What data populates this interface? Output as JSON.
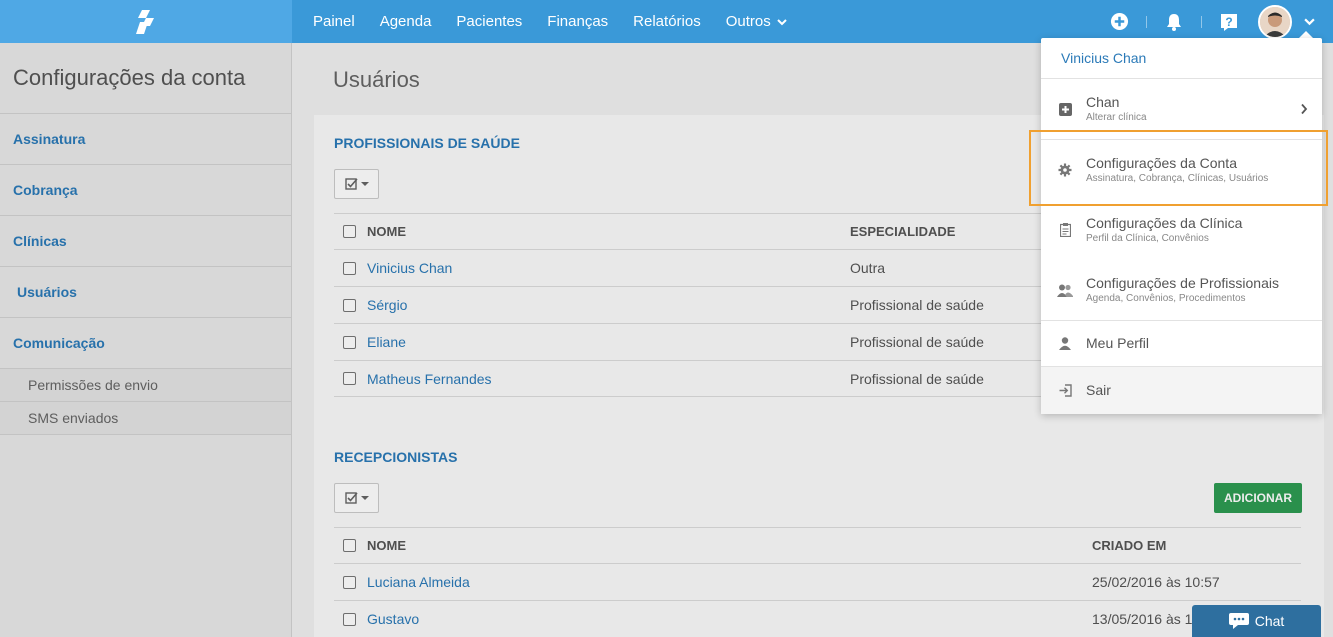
{
  "nav": {
    "items": [
      "Painel",
      "Agenda",
      "Pacientes",
      "Finanças",
      "Relatórios",
      "Outros"
    ]
  },
  "sidebar": {
    "title": "Configurações da conta",
    "items": [
      "Assinatura",
      "Cobrança",
      "Clínicas",
      "Usuários",
      "Comunicação"
    ],
    "active": "Usuários",
    "subitems": [
      "Permissões de envio",
      "SMS enviados"
    ]
  },
  "main": {
    "page_title": "Usuários",
    "professionals": {
      "title": "PROFISSIONAIS DE SAÚDE",
      "columns": [
        "NOME",
        "ESPECIALIDADE"
      ],
      "rows": [
        {
          "name": "Vinicius Chan",
          "specialty": "Outra"
        },
        {
          "name": "Sérgio",
          "specialty": "Profissional de saúde"
        },
        {
          "name": "Eliane",
          "specialty": "Profissional de saúde"
        },
        {
          "name": "Matheus Fernandes",
          "specialty": "Profissional de saúde"
        }
      ]
    },
    "receptionists": {
      "title": "RECEPCIONISTAS",
      "add_label": "ADICIONAR",
      "columns": [
        "NOME",
        "CRIADO EM"
      ],
      "rows": [
        {
          "name": "Luciana Almeida",
          "created": "25/02/2016 às 10:57"
        },
        {
          "name": "Gustavo",
          "created": "13/05/2016 às 1"
        }
      ]
    }
  },
  "dropdown": {
    "user_name": "Vinicius Chan",
    "items": [
      {
        "title": "Chan",
        "subtitle": "Alterar clínica",
        "icon": "plus-square-icon"
      },
      {
        "title": "Configurações da Conta",
        "subtitle": "Assinatura, Cobrança, Clínicas, Usuários",
        "icon": "gear-icon"
      },
      {
        "title": "Configurações da Clínica",
        "subtitle": "Perfil da Clínica, Convênios",
        "icon": "clipboard-icon"
      },
      {
        "title": "Configurações de Profissionais",
        "subtitle": "Agenda, Convênios, Procedimentos",
        "icon": "users-icon"
      },
      {
        "title": "Meu Perfil",
        "subtitle": "",
        "icon": "user-icon"
      },
      {
        "title": "Sair",
        "subtitle": "",
        "icon": "sign-out-icon"
      }
    ]
  },
  "chat": {
    "label": "Chat"
  },
  "colors": {
    "topbar": "#3a99d8",
    "link": "#2b7ab8",
    "add_button": "#2e9b52",
    "highlight": "#f0a030",
    "chat": "#2e6f9f"
  }
}
